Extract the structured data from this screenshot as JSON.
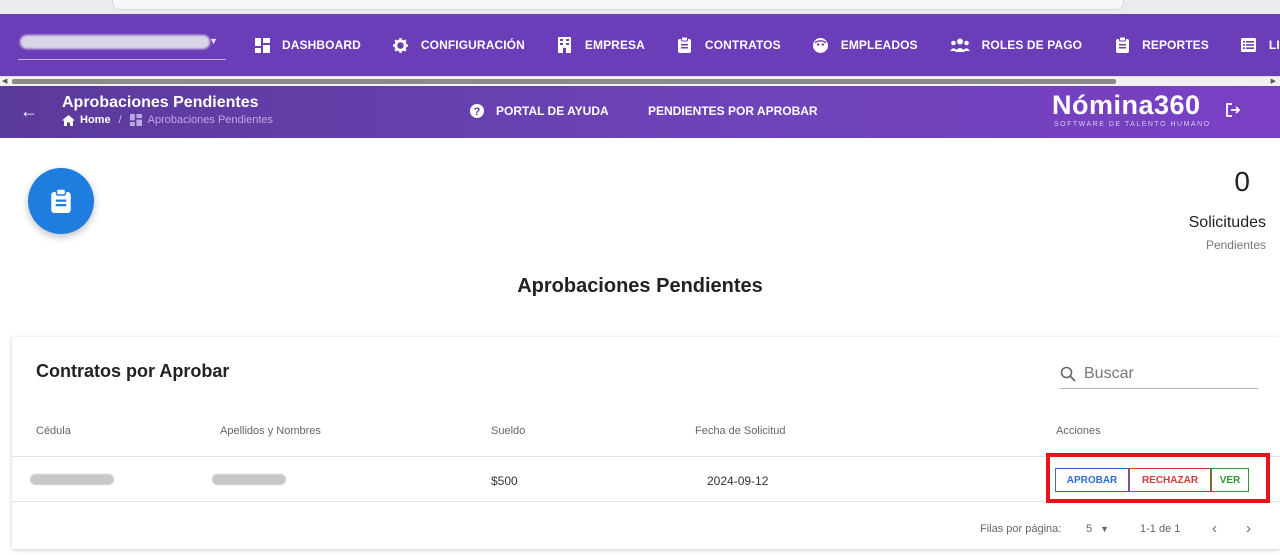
{
  "nav": {
    "company_value": "",
    "items": [
      {
        "label": "DASHBOARD",
        "icon": "dashboard-icon"
      },
      {
        "label": "CONFIGURACIÓN",
        "icon": "gear-icon"
      },
      {
        "label": "EMPRESA",
        "icon": "building-icon"
      },
      {
        "label": "CONTRATOS",
        "icon": "clipboard-icon"
      },
      {
        "label": "EMPLEADOS",
        "icon": "face-icon"
      },
      {
        "label": "ROLES DE PAGO",
        "icon": "users-icon"
      },
      {
        "label": "REPORTES",
        "icon": "clipboard-icon"
      },
      {
        "label": "LI",
        "icon": "list-icon"
      }
    ]
  },
  "subheader": {
    "title": "Aprobaciones Pendientes",
    "breadcrumb_home": "Home",
    "breadcrumb_current": "Aprobaciones Pendientes",
    "help_label": "PORTAL DE AYUDA",
    "pending_label": "PENDIENTES POR APROBAR",
    "brand_name": "Nómina360",
    "brand_tagline": "SOFTWARE DE TALENTO HUMANO"
  },
  "stats": {
    "count": "0",
    "label": "Solicitudes",
    "sublabel": "Pendientes"
  },
  "section_title": "Aprobaciones Pendientes",
  "card": {
    "title": "Contratos por Aprobar",
    "search_placeholder": "Buscar",
    "columns": [
      "Cédula",
      "Apellidos y Nombres",
      "Sueldo",
      "Fecha de Solicitud",
      "Acciones"
    ],
    "rows": [
      {
        "cedula": "",
        "nombres": "",
        "sueldo": "$500",
        "fecha": "2024-09-12"
      }
    ],
    "actions": {
      "approve": "APROBAR",
      "reject": "RECHAZAR",
      "view": "VER"
    },
    "pager": {
      "rows_label": "Filas por página:",
      "rows_value": "5",
      "range": "1-1 de 1"
    }
  },
  "colors": {
    "nav_bg": "#6c3db8",
    "badge_bg": "#1f7de0",
    "highlight": "#e8121a"
  }
}
